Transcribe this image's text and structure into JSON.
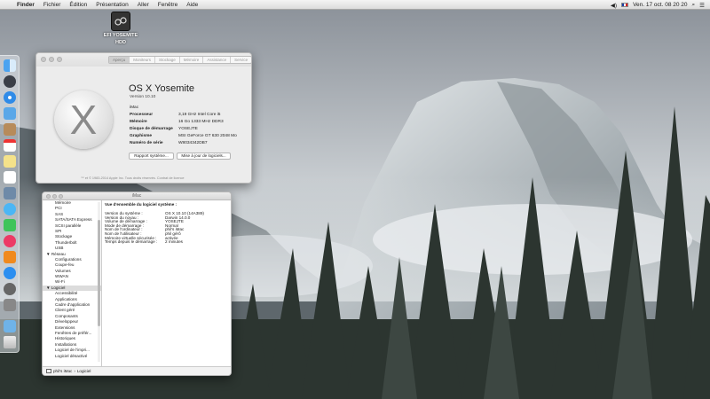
{
  "menubar": {
    "apple": "",
    "items": [
      "Finder",
      "Fichier",
      "Édition",
      "Présentation",
      "Aller",
      "Fenêtre",
      "Aide"
    ],
    "clock": "Ven. 17 oct.  08 20 20"
  },
  "desktop": {
    "disk_label_line1": "EFI YOSEMITE",
    "disk_label_line2": "HDD"
  },
  "about_window": {
    "tabs": [
      "Aperçu",
      "Moniteurs",
      "Stockage",
      "Mémoire",
      "Assistance",
      "Service"
    ],
    "os_title": "OS X Yosemite",
    "version": "Version 10.10",
    "model": "iMac",
    "specs": [
      {
        "k": "Processeur",
        "v": "3,19 GHz Intel Core i5"
      },
      {
        "k": "Mémoire",
        "v": "16 Go 1333 MHz DDR3"
      },
      {
        "k": "Disque de démarrage",
        "v": "YOSEJTE"
      },
      {
        "k": "Graphisme",
        "v": "MSI GeForce GT 630 2048 Mo"
      },
      {
        "k": "Numéro de série",
        "v": "W8034342DB7"
      }
    ],
    "btn_report": "Rapport système...",
    "btn_update": "Mise à jour de logiciels...",
    "footer": "™ et © 1983-2014 Apple Inc. Tous droits réservés. Contrat de licence"
  },
  "sysinfo_window": {
    "title": "iMac",
    "sidebar": [
      {
        "label": "Mémoire",
        "level": 1
      },
      {
        "label": "PCI",
        "level": 1
      },
      {
        "label": "SAS",
        "level": 1
      },
      {
        "label": "SATA/SATA Express",
        "level": 1
      },
      {
        "label": "SCSI parallèle",
        "level": 1
      },
      {
        "label": "SPI",
        "level": 1
      },
      {
        "label": "Stockage",
        "level": 1
      },
      {
        "label": "Thunderbolt",
        "level": 1
      },
      {
        "label": "USB",
        "level": 1
      },
      {
        "label": "▼ Réseau",
        "level": 0
      },
      {
        "label": "Configurations",
        "level": 1
      },
      {
        "label": "Coupe-feu",
        "level": 1
      },
      {
        "label": "Volumes",
        "level": 1
      },
      {
        "label": "WWAN",
        "level": 1
      },
      {
        "label": "Wi-Fi",
        "level": 1
      },
      {
        "label": "▼ Logiciel",
        "level": 0,
        "selected": true
      },
      {
        "label": "Accessibilité",
        "level": 1
      },
      {
        "label": "Applications",
        "level": 1
      },
      {
        "label": "Cadre d'application",
        "level": 1
      },
      {
        "label": "Client géré",
        "level": 1
      },
      {
        "label": "Composants",
        "level": 1
      },
      {
        "label": "Développeur",
        "level": 1
      },
      {
        "label": "Extensions",
        "level": 1
      },
      {
        "label": "Fenêtres de préfér...",
        "level": 1
      },
      {
        "label": "Historiques",
        "level": 1
      },
      {
        "label": "Installations",
        "level": 1
      },
      {
        "label": "Logiciel de l'impri...",
        "level": 1
      },
      {
        "label": "Logiciel désactivé",
        "level": 1
      }
    ],
    "detail_heading": "Vue d'ensemble du logiciel système :",
    "detail": [
      {
        "k": "Version du système :",
        "v": "OS X 10.10 (14A389)"
      },
      {
        "k": "Version du noyau :",
        "v": "Darwin 14.0.0"
      },
      {
        "k": "Volume de démarrage :",
        "v": "YOSEJTE"
      },
      {
        "k": "Mode de démarrage :",
        "v": "Normal"
      },
      {
        "k": "Nom de l'ordinateur :",
        "v": "phil's iMac"
      },
      {
        "k": "Nom de l'utilisateur :",
        "v": "phil gérô"
      },
      {
        "k": "Mémoire virtuelle sécurisée :",
        "v": "activée"
      },
      {
        "k": "Temps depuis le démarrage :",
        "v": "2 minutes"
      }
    ],
    "pathbar": [
      "phil's iMac",
      "›",
      "Logiciel"
    ]
  }
}
